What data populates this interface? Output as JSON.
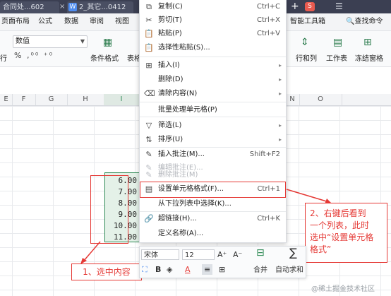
{
  "tabs": [
    {
      "label": "合同处...602"
    },
    {
      "label": "2_其它...0412",
      "badge": "W"
    }
  ],
  "tab_close": "×",
  "tab_plus": "+",
  "window_badge": "S",
  "menubar": {
    "items": [
      "页面布局",
      "公式",
      "数据",
      "审阅",
      "视图"
    ],
    "right_item": "智能工具箱",
    "search": "查找命令"
  },
  "toolbar": {
    "number_format": "数值",
    "left_label": "行",
    "percent_row": "% ,⁰⁰ ⁺⁰",
    "conditional_format": "条件格式",
    "table_label": "表格",
    "rows_cols": "行和列",
    "worksheet": "工作表",
    "freeze": "冻结窗格"
  },
  "columns": [
    "E",
    "F",
    "G",
    "H",
    "I",
    "J",
    "K",
    "L",
    "M",
    "N",
    "O"
  ],
  "cells": [
    "6.00",
    "7.00",
    "8.00",
    "9.00",
    "10.00",
    "11.00"
  ],
  "context_menu": {
    "items": [
      {
        "icon": "copy-icon",
        "glyph": "⧉",
        "label": "复制(C)",
        "shortcut": "Ctrl+C"
      },
      {
        "icon": "scissors-icon",
        "glyph": "✂",
        "label": "剪切(T)",
        "shortcut": "Ctrl+X"
      },
      {
        "icon": "paste-icon",
        "glyph": "📋",
        "label": "粘贴(P)",
        "shortcut": "Ctrl+V"
      },
      {
        "icon": "paste-special-icon",
        "glyph": "📋",
        "label": "选择性粘贴(S)..."
      },
      {
        "icon": "insert-icon",
        "glyph": "⊞",
        "label": "插入(I)",
        "arrow": true
      },
      {
        "label": "删除(D)",
        "arrow": true
      },
      {
        "icon": "eraser-icon",
        "glyph": "⌫",
        "label": "清除内容(N)",
        "arrow": true
      },
      {
        "label": "批量处理单元格(P)"
      },
      {
        "icon": "filter-icon",
        "glyph": "▽",
        "label": "筛选(L)",
        "arrow": true
      },
      {
        "icon": "sort-icon",
        "glyph": "⇅",
        "label": "排序(U)",
        "arrow": true
      },
      {
        "icon": "comment-icon",
        "glyph": "✎",
        "label": "插入批注(M)...",
        "shortcut": "Shift+F2"
      },
      {
        "icon": "edit-comment-icon",
        "glyph": "✎",
        "label": "编辑批注(E)...",
        "disabled": true
      },
      {
        "icon": "delete-comment-icon",
        "glyph": "✎",
        "label": "删除批注(M)",
        "disabled": true
      },
      {
        "icon": "format-cells-icon",
        "glyph": "▤",
        "label": "设置单元格格式(F)...",
        "shortcut": "Ctrl+1"
      },
      {
        "label": "从下拉列表中选择(K)..."
      },
      {
        "icon": "link-icon",
        "glyph": "🔗",
        "label": "超链接(H)...",
        "shortcut": "Ctrl+K"
      },
      {
        "label": "定义名称(A)..."
      }
    ]
  },
  "minibar": {
    "font": "宋体",
    "size": "12",
    "grow": "A⁺",
    "shrink": "A⁻",
    "merge": "合并",
    "autosum": "自动求和",
    "bold": "B"
  },
  "annotations": {
    "step1": "1、选中内容",
    "step2_lines": [
      "2、右键后看到",
      "一个列表，此时",
      "选中“设置单元格",
      "格式”"
    ]
  },
  "watermark": "@稀土掘金技术社区",
  "colors": {
    "accent_red": "#e53935",
    "selection_green": "#2e8a55"
  }
}
